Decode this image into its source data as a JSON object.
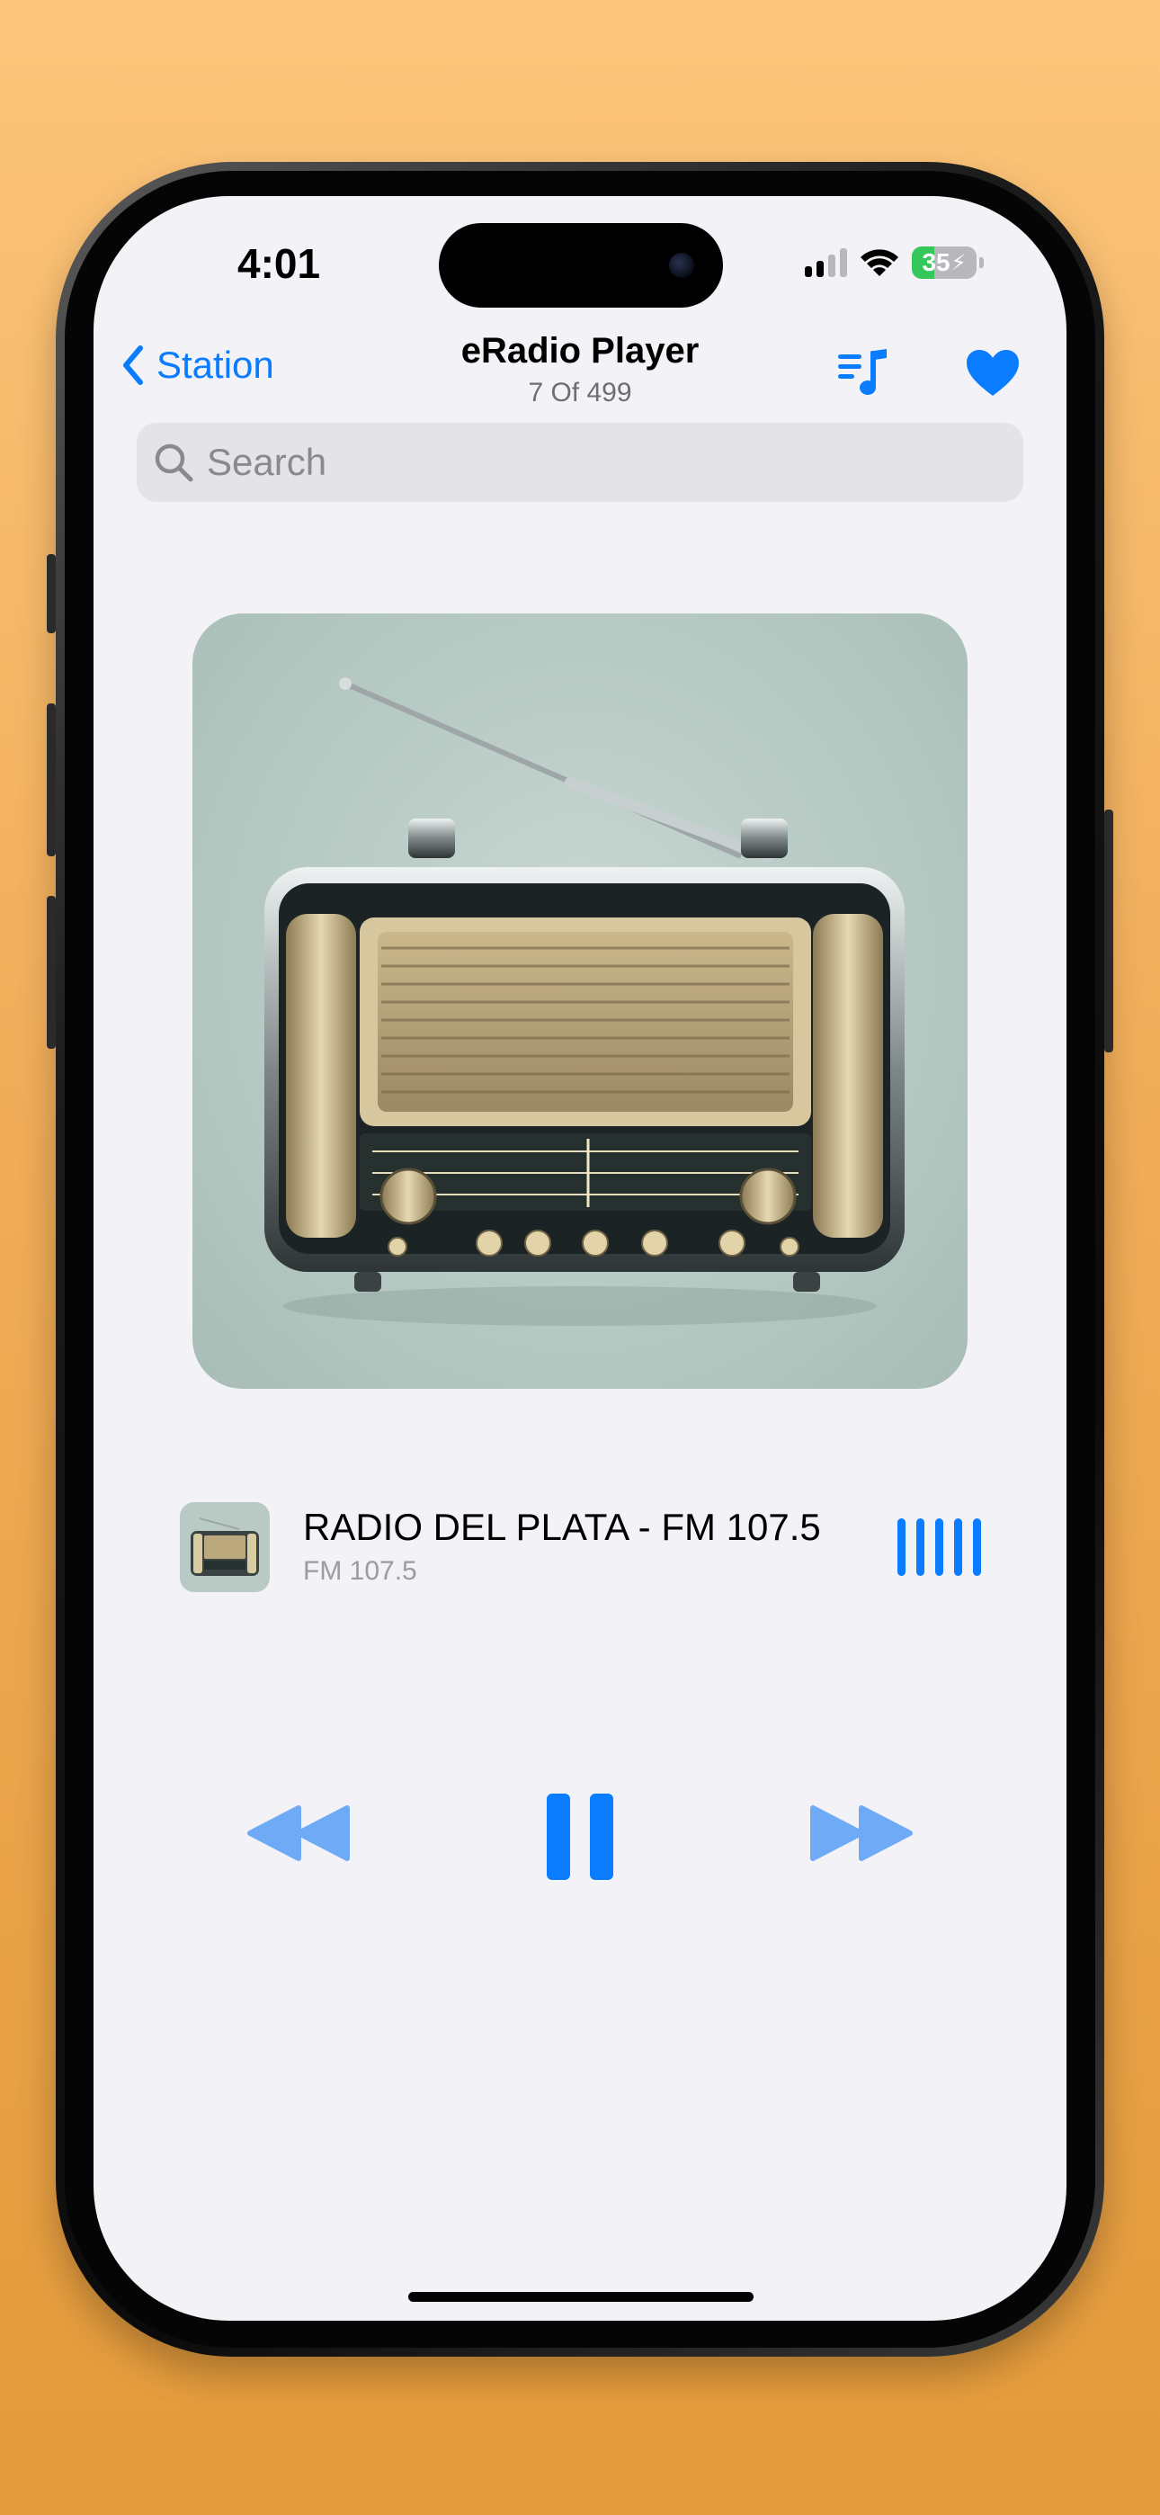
{
  "status_bar": {
    "time": "4:01",
    "battery_level": "35",
    "battery_fraction": 0.35,
    "signal_bars_active": 2,
    "signal_bars_total": 4,
    "icons": [
      "cellular-signal-icon",
      "wifi-icon",
      "battery-charging-icon"
    ]
  },
  "nav": {
    "back_label": "Station",
    "title": "eRadio Player",
    "subtitle": "7 Of 499",
    "queue_icon": "playlist-music-icon",
    "favorite_icon": "heart-filled-icon"
  },
  "search": {
    "placeholder": "Search",
    "value": ""
  },
  "now_playing": {
    "title": "RADIO DEL PLATA - FM 107.5",
    "subtitle": "FM 107.5",
    "indicator_icon": "audio-bars-icon"
  },
  "controls": {
    "rewind_icon": "backward-icon",
    "pause_icon": "pause-icon",
    "forward_icon": "forward-icon"
  },
  "colors": {
    "accent": "#0a7cff",
    "accent_light": "#6eaaf5",
    "background": "#f2f2f7",
    "battery_green": "#34c759"
  }
}
